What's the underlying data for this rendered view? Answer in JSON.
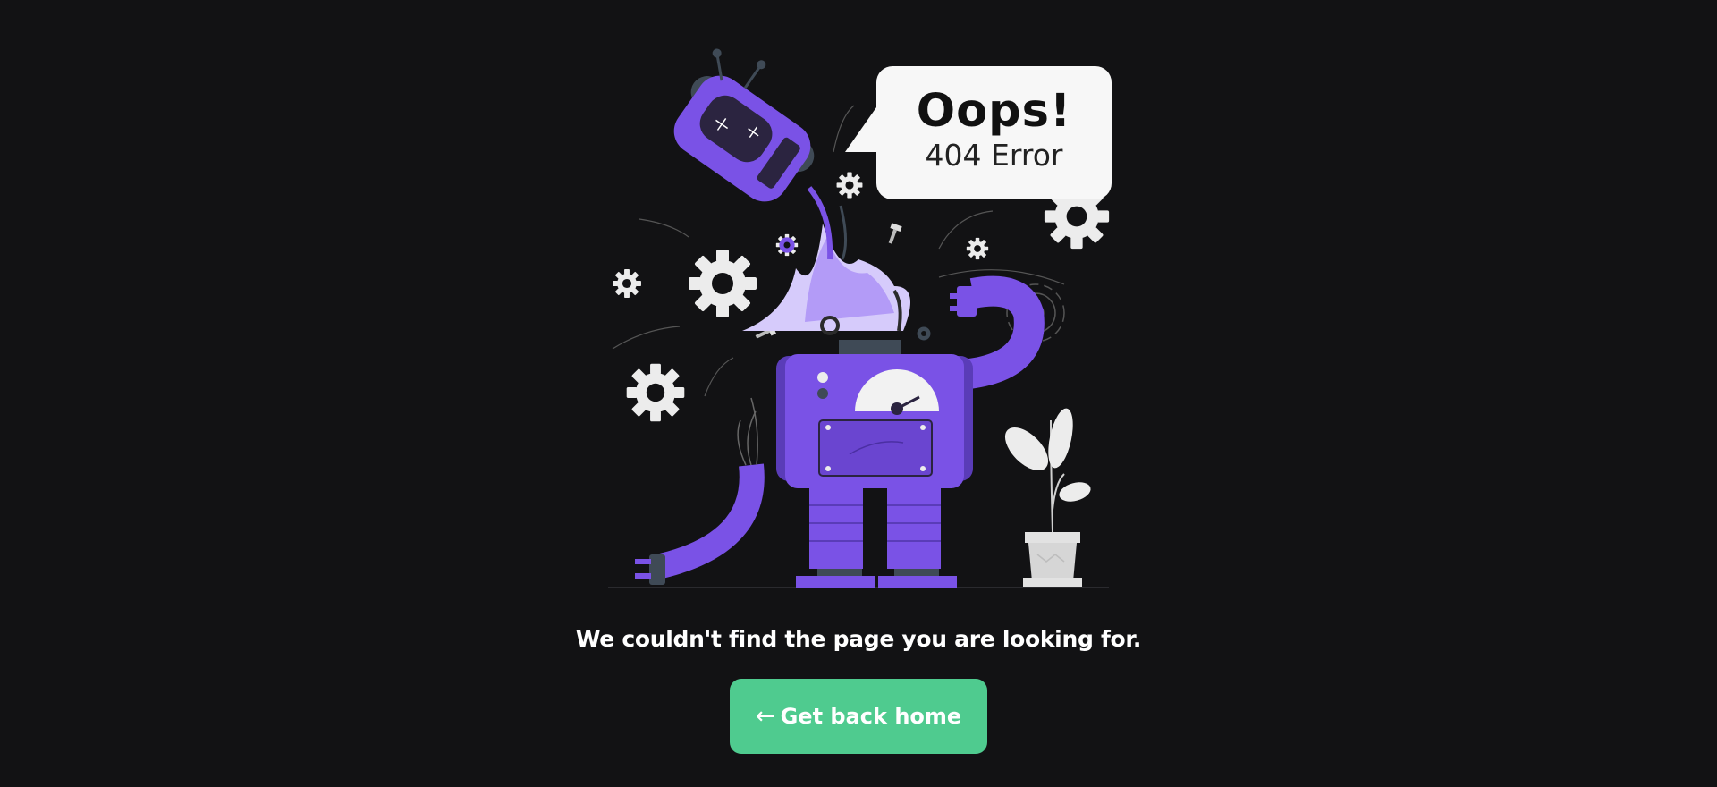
{
  "bubble": {
    "title": "Oops!",
    "subtitle": "404 Error"
  },
  "message": "We couldn't find the page you are looking for.",
  "home_button": {
    "arrow": "←",
    "label": "Get back home"
  },
  "colors": {
    "background": "#121214",
    "robot_purple": "#7a52e6",
    "button_green": "#4fcb8f"
  },
  "icons": [
    "robot-illustration",
    "gear-icon",
    "screw-icon",
    "plant-icon"
  ]
}
